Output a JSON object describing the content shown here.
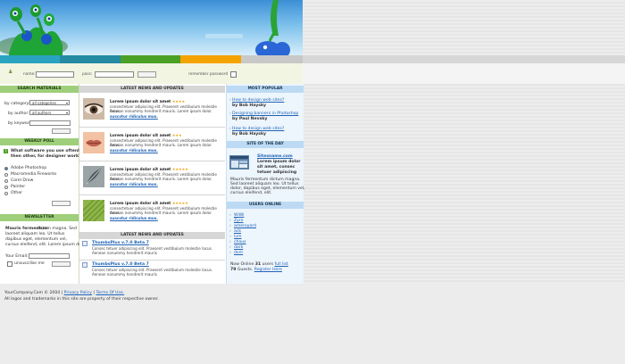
{
  "login": {
    "name_label": "name:",
    "pass_label": "pass:",
    "remember_label": "remember password"
  },
  "left": {
    "search_header": "SEARCH MATERIALS",
    "by_category_label": "by category:",
    "by_category_value": "all categories",
    "by_author_label": "by author:",
    "by_author_value": "all authors",
    "by_keyword_label": "by keyword:",
    "poll_header": "WEEKLY POLL",
    "poll_question_1": "What software you use oftenly",
    "poll_question_2": "then other, for designer work?",
    "poll_options": [
      "Adobe Photoshop",
      "Macromedia Fireworks",
      "Corel Draw",
      "Painter",
      "Other"
    ],
    "newsletter_header": "NEWSLETTER",
    "newsletter_bold": "Mauris fermentum",
    "newsletter_text_1": "dictum magna. Sed",
    "newsletter_text_2": "laoreet aliquam leo. Ut tellus",
    "newsletter_text_3": "dapibus eget, elementum vel,",
    "newsletter_text_4": "cursus eleifend, elit. Lorem ipsum dolor.",
    "email_label": "Your Email:",
    "unsubscribe_label": "unsuscribe me"
  },
  "middle": {
    "latest_header": "LATEST NEWS AND UPDATES",
    "items": [
      {
        "title": "Lorem ipsum dolor sit amet",
        "stars": "★★★★",
        "line1": "consectetuer adipiscing elit. Praesent vestibulum molestie lacus.",
        "line2": "Aenean nonummy hendrerit mauris. Lorem ipsum dolor.",
        "link": "suscotur ridiculus mus."
      },
      {
        "title": "Lorem ipsum dolor sit amet",
        "stars": "★★★",
        "line1": "consectetuer adipiscing elit. Praesent vestibulum molestie lacus.",
        "line2": "Aenean nonummy hendrerit mauris. Lorem ipsum dolor.",
        "link": "suscotur ridiculus mus."
      },
      {
        "title": "Lorem ipsum dolor sit amet",
        "stars": "★★★★★",
        "line1": "consectetuer adipiscing elit. Praesent vestibulum molestie lacus.",
        "line2": "Aenean nonummy hendrerit mauris. Lorem ipsum dolor.",
        "link": "suscotur ridiculus mus."
      },
      {
        "title": "Lorem ipsum dolor sit amet",
        "stars": "★★★★★",
        "line1": "consectetuer adipiscing elit. Praesent vestibulum molestie lacus.",
        "line2": "Aenean nonummy hendrerit mauris. Lorem ipsum dolor.",
        "link": "suscotur ridiculus mus."
      }
    ],
    "latest_header_2": "LATEST NEWS AND UPDATES",
    "downloads": [
      {
        "title": "ThumbsPlus v.7.0 Beta 7",
        "line1": "Consec tetuer adipiscing elit. Praesent vestibulum molestie lacus.",
        "line2": "Aenean nonummy hendrerit mauris"
      },
      {
        "title": "ThumbsPlus v.7.0 Beta 7",
        "line1": "Consec tetuer adipiscing elit. Praesent vestibulum molestie lacus.",
        "line2": "Aenean nonummy hendrerit mauris"
      }
    ]
  },
  "right": {
    "popular_header": "MOST POPULAR",
    "popular": [
      {
        "title": "How to design web sites?",
        "by": "by Bob Haysky"
      },
      {
        "title": "Designing banners in Photoshop",
        "by": "by Paul Nevsky"
      },
      {
        "title": "How to design web sites?",
        "by": "by Bob Haysky"
      }
    ],
    "site_header": "SITE OF THE DAY",
    "site_link": "Sitesname.com",
    "site_desc_1": "Lorem ipsum dolor",
    "site_desc_2": "sit amet, consec",
    "site_desc_3": "tetuer adipiscing",
    "site_text_1": "Mauris fermentum dictum magna.",
    "site_text_2": "Sed laoreet aliquam leo. Ut tellus",
    "site_text_3": "dolor, dapibus eget, elementum vel,",
    "site_text_4": "cursus eleifend, elit.",
    "users_header": "USERS ONLINE",
    "users": [
      "WiWi",
      "Zyro",
      "ameroyard",
      "ack",
      "lvm",
      "chaus",
      "dark",
      "dvm"
    ],
    "online_prefix": "Now Online",
    "online_count": "31",
    "online_users_word": "users",
    "full_list": "full list",
    "guests_count": "79",
    "guests_word": "Guests.",
    "register_link": "Register Here"
  },
  "footer": {
    "copyright": "YourCompany.Com © 2004 |",
    "privacy": "Privacy Policy",
    "sep": "|",
    "terms": "Terms Of Use.",
    "line2": "All logos and trademarks in this site are property of their respective owner."
  },
  "colors": {
    "green": "#4aa126",
    "teal": "#2aa3c0",
    "orange": "#f5a300",
    "gray": "#c8c8c8"
  }
}
